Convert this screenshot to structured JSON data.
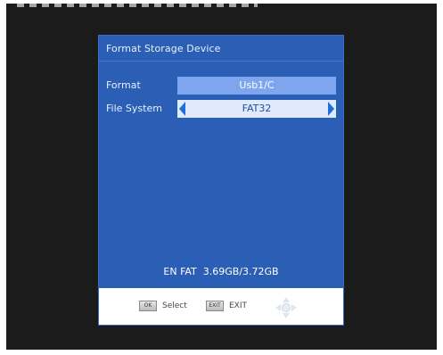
{
  "dialog": {
    "title": "Format Storage Device",
    "format_label": "Format",
    "format_value": "Usb1/C",
    "fs_label": "File System",
    "fs_value": "FAT32",
    "capacity_text": "EN FAT  3.69GB/3.72GB"
  },
  "footer": {
    "ok_icon_text": "OK",
    "select_label": "Select",
    "exit_icon_text": "EXIT",
    "exit_label": "EXIT"
  },
  "colors": {
    "dialog_bg": "#2a5fb5",
    "format_value_bg": "#7da6ee",
    "fs_value_bg": "#dfeafc",
    "fs_value_text": "#214f9f",
    "arrow": "#1f6fd6",
    "footer_bg": "#ffffff"
  },
  "icons": {
    "left_arrow": "left-arrow-icon",
    "right_arrow": "right-arrow-icon",
    "ok_key": "ok-key-icon",
    "exit_key": "exit-key-icon",
    "nav_pad": "dpad-icon"
  }
}
